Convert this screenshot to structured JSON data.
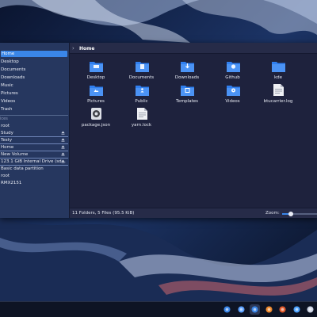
{
  "breadcrumb": {
    "label": "Home"
  },
  "sidebar": {
    "places": [
      {
        "label": "Home",
        "selected": true
      },
      {
        "label": "Desktop"
      },
      {
        "label": "Documents"
      },
      {
        "label": "Downloads"
      },
      {
        "label": "Music"
      },
      {
        "label": "Pictures"
      },
      {
        "label": "Videos"
      },
      {
        "label": "Trash"
      }
    ],
    "devices_heading": "ices",
    "devices": [
      {
        "label": "root",
        "eject": false
      },
      {
        "label": "Study",
        "eject": true
      },
      {
        "label": "Testy",
        "eject": true
      },
      {
        "label": "Home",
        "eject": true
      },
      {
        "label": "New Volume",
        "eject": true
      },
      {
        "label": "123.1 GiB Internal Drive (sd...",
        "eject": true
      },
      {
        "label": "Basic data partition",
        "eject": false
      },
      {
        "label": "root",
        "eject": false
      },
      {
        "label": "RMX2151",
        "eject": false
      }
    ]
  },
  "files": [
    {
      "label": "Desktop",
      "icon": "folder-desktop-icon",
      "kind": "folder"
    },
    {
      "label": "Documents",
      "icon": "folder-documents-icon",
      "kind": "folder"
    },
    {
      "label": "Downloads",
      "icon": "folder-downloads-icon",
      "kind": "folder"
    },
    {
      "label": "Github",
      "icon": "folder-github-icon",
      "kind": "folder"
    },
    {
      "label": "kde",
      "icon": "folder-icon",
      "kind": "folder"
    },
    {
      "label": "Pictures",
      "icon": "folder-pictures-icon",
      "kind": "folder"
    },
    {
      "label": "Public",
      "icon": "folder-public-icon",
      "kind": "folder"
    },
    {
      "label": "Templates",
      "icon": "folder-templates-icon",
      "kind": "folder"
    },
    {
      "label": "Videos",
      "icon": "folder-videos-icon",
      "kind": "folder"
    },
    {
      "label": "btucarrier.log",
      "icon": "text-file-icon",
      "kind": "file"
    },
    {
      "label": "package.json",
      "icon": "json-file-icon",
      "kind": "file"
    },
    {
      "label": "yarn.lock",
      "icon": "lock-file-icon",
      "kind": "file"
    }
  ],
  "status": {
    "summary": "11 Folders, 5 Files (95.5 KiB)",
    "zoom_label": "Zoom:",
    "zoom_level": 0.25
  },
  "taskbar": [
    {
      "icon": "finder-icon"
    },
    {
      "icon": "dot-icon"
    },
    {
      "icon": "files-icon",
      "active": true
    },
    {
      "icon": "firefox-icon"
    },
    {
      "icon": "brave-icon"
    },
    {
      "icon": "settings-icon"
    },
    {
      "icon": "terminal-icon"
    }
  ],
  "colors": {
    "accent": "#3a86e8",
    "folder": "#2f7ff0",
    "window_bg": "#1e223d",
    "sidebar_bg": "#273a62"
  }
}
